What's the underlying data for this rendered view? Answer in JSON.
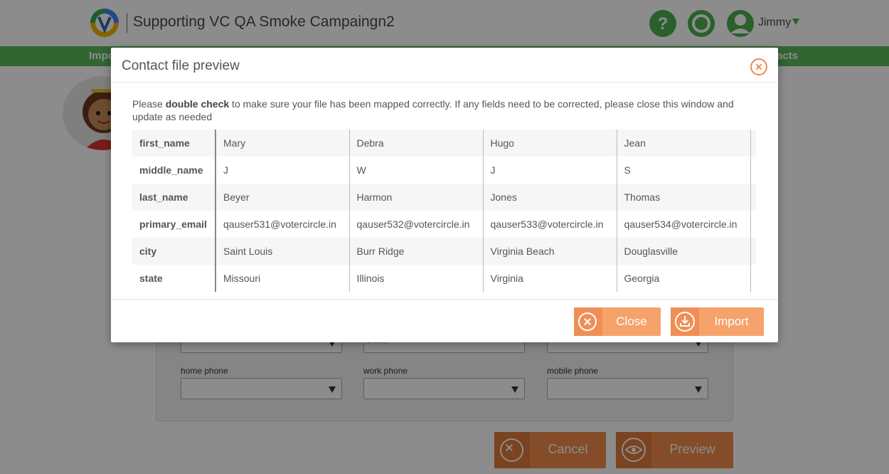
{
  "header": {
    "title": "Supporting VC QA Smoke Campaingn2",
    "user_name": "Jimmy"
  },
  "nav": {
    "left_partial": "Impo",
    "right_partial": "tacts"
  },
  "form": {
    "state_placeholder": "State",
    "home_phone_label": "home phone",
    "work_phone_label": "work phone",
    "mobile_phone_label": "mobile phone"
  },
  "page_buttons": {
    "cancel_label": "Cancel",
    "preview_label": "Preview"
  },
  "modal": {
    "title": "Contact file preview",
    "instruction_pre": "Please ",
    "instruction_bold": "double check",
    "instruction_post": " to make sure your file has been mapped correctly. If any fields need to be corrected, please close this window and update as needed",
    "close_label": "Close",
    "import_label": "Import"
  },
  "preview": {
    "rows": [
      {
        "field": "first_name",
        "values": [
          "Mary",
          "Debra",
          "Hugo",
          "Jean"
        ]
      },
      {
        "field": "middle_name",
        "values": [
          "J",
          "W",
          "J",
          "S"
        ]
      },
      {
        "field": "last_name",
        "values": [
          "Beyer",
          "Harmon",
          "Jones",
          "Thomas"
        ]
      },
      {
        "field": "primary_email",
        "values": [
          "qauser531@votercircle.in",
          "qauser532@votercircle.in",
          "qauser533@votercircle.in",
          "qauser534@votercircle.in"
        ]
      },
      {
        "field": "city",
        "values": [
          "Saint Louis",
          "Burr Ridge",
          "Virginia Beach",
          "Douglasville"
        ]
      },
      {
        "field": "state",
        "values": [
          "Missouri",
          "Illinois",
          "Virginia",
          "Georgia"
        ]
      }
    ]
  },
  "colors": {
    "accent_orange": "#f08a4b",
    "brand_green": "#5cb85c"
  },
  "icons": [
    "help-icon",
    "circle-icon",
    "user-avatar-icon",
    "close-circle-icon",
    "import-icon",
    "eye-icon"
  ]
}
